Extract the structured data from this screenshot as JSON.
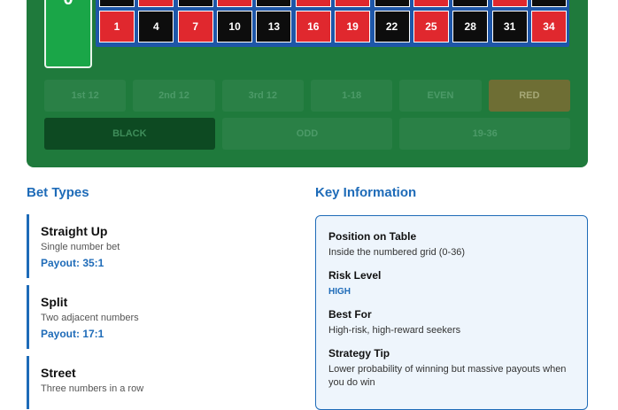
{
  "board": {
    "zero": "0",
    "top_row": [
      {
        "n": "",
        "color": "black"
      },
      {
        "n": "",
        "color": "red"
      },
      {
        "n": "",
        "color": "black"
      },
      {
        "n": "",
        "color": "red"
      },
      {
        "n": "",
        "color": "black"
      },
      {
        "n": "",
        "color": "red"
      },
      {
        "n": "",
        "color": "red"
      },
      {
        "n": "",
        "color": "black"
      },
      {
        "n": "",
        "color": "red"
      },
      {
        "n": "",
        "color": "black"
      },
      {
        "n": "",
        "color": "red"
      },
      {
        "n": "",
        "color": "black"
      }
    ],
    "bottom_row": [
      {
        "n": "1",
        "color": "red"
      },
      {
        "n": "4",
        "color": "black"
      },
      {
        "n": "7",
        "color": "red"
      },
      {
        "n": "10",
        "color": "black"
      },
      {
        "n": "13",
        "color": "black"
      },
      {
        "n": "16",
        "color": "red"
      },
      {
        "n": "19",
        "color": "red"
      },
      {
        "n": "22",
        "color": "black"
      },
      {
        "n": "25",
        "color": "red"
      },
      {
        "n": "28",
        "color": "black"
      },
      {
        "n": "31",
        "color": "black"
      },
      {
        "n": "34",
        "color": "red"
      }
    ],
    "outside_row1": [
      "1st 12",
      "2nd 12",
      "3rd 12",
      "1-18",
      "EVEN",
      "RED"
    ],
    "outside_row2": [
      "BLACK",
      "ODD",
      "19-36"
    ]
  },
  "bet_types": {
    "title": "Bet Types",
    "items": [
      {
        "name": "Straight Up",
        "desc": "Single number bet",
        "payout": "Payout: 35:1"
      },
      {
        "name": "Split",
        "desc": "Two adjacent numbers",
        "payout": "Payout: 17:1"
      },
      {
        "name": "Street",
        "desc": "Three numbers in a row",
        "payout": ""
      }
    ]
  },
  "key_info": {
    "title": "Key Information",
    "position_label": "Position on Table",
    "position_value": "Inside the numbered grid (0-36)",
    "risk_label": "Risk Level",
    "risk_value": "HIGH",
    "best_label": "Best For",
    "best_value": "High-risk, high-reward seekers",
    "tip_label": "Strategy Tip",
    "tip_value": "Lower probability of winning but massive payouts when you do win"
  },
  "colors": {
    "red": "#e0282e",
    "black": "#0d0d0d",
    "board": "#1f7a3c",
    "accent": "#1e6bb8"
  }
}
